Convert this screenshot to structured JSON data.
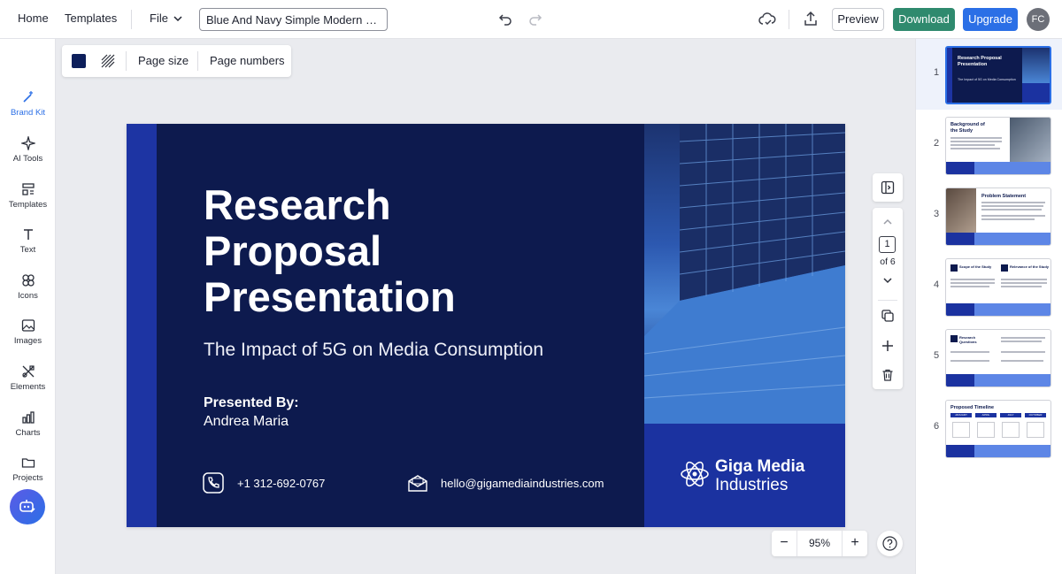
{
  "topbar": {
    "home": "Home",
    "templates": "Templates",
    "file": "File",
    "doc_title": "Blue And Navy Simple Modern Pr...",
    "preview": "Preview",
    "download": "Download",
    "upgrade": "Upgrade",
    "avatar_initials": "FC"
  },
  "sidebar": {
    "items": [
      {
        "label": "Brand Kit",
        "icon": "magic-wand-icon"
      },
      {
        "label": "AI Tools",
        "icon": "sparkle-icon"
      },
      {
        "label": "Templates",
        "icon": "templates-icon"
      },
      {
        "label": "Text",
        "icon": "text-icon"
      },
      {
        "label": "Icons",
        "icon": "shapes-icon"
      },
      {
        "label": "Images",
        "icon": "image-icon"
      },
      {
        "label": "Elements",
        "icon": "elements-icon"
      },
      {
        "label": "Charts",
        "icon": "bar-chart-icon"
      },
      {
        "label": "Projects",
        "icon": "folder-icon"
      }
    ]
  },
  "toolbar": {
    "page_size": "Page size",
    "page_numbers": "Page numbers",
    "background_color": "#0d1f5b"
  },
  "slide": {
    "title_lines": [
      "Research",
      "Proposal",
      "Presentation"
    ],
    "subtitle": "The Impact of 5G on Media Consumption",
    "presented_by": "Presented By:",
    "presenter": "Andrea Maria",
    "phone": "+1 312-692-0767",
    "email": "hello@gigamediaindustries.com",
    "brand_line1": "Giga Media",
    "brand_line2": "Industries",
    "colors": {
      "navy": "#0d1a4e",
      "stripe": "#1d34a3",
      "brand_block": "#1b32a0"
    }
  },
  "page_nav": {
    "current": "1",
    "of_label": "of 6"
  },
  "zoom": {
    "minus": "−",
    "value": "95%",
    "plus": "+"
  },
  "pages": [
    {
      "index": "1",
      "title": "Research Proposal Presentation",
      "subtitle": "The Impact of 5G on Media Consumption"
    },
    {
      "index": "2",
      "title": "Background of the Study"
    },
    {
      "index": "3",
      "title": "Problem Statement"
    },
    {
      "index": "4",
      "title_a": "Scope of the Study",
      "title_b": "Relevance of the Study"
    },
    {
      "index": "5",
      "title": "Research Questions"
    },
    {
      "index": "6",
      "title": "Proposed Timeline",
      "months": [
        "JANUARY",
        "APRIL",
        "JULY",
        "OCTOBER"
      ]
    }
  ]
}
